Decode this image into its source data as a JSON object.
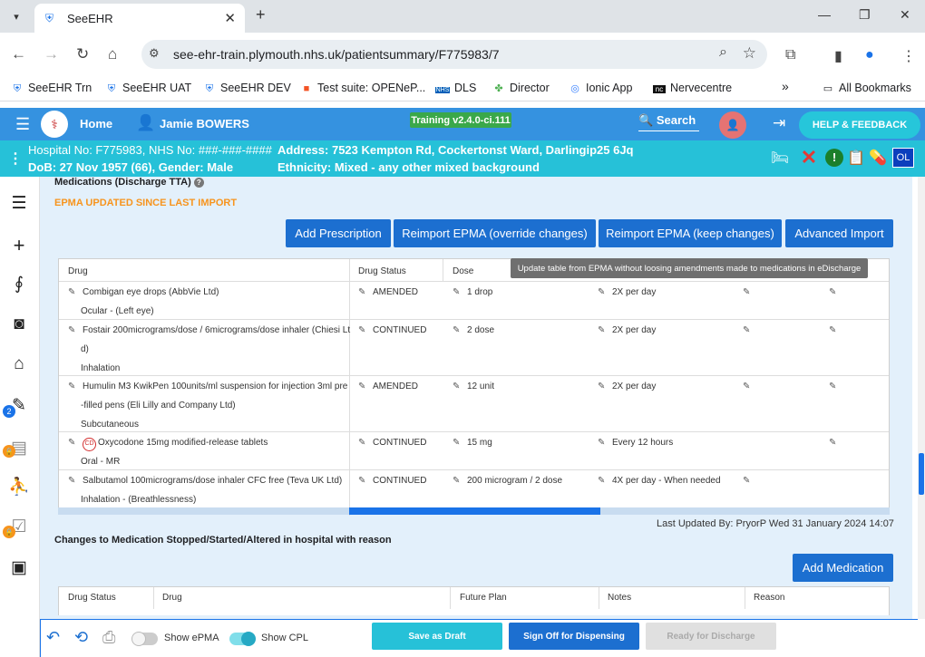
{
  "browser": {
    "tab_title": "SeeEHR",
    "url": "see-ehr-train.plymouth.nhs.uk/patientsummary/F775983/7",
    "bookmarks": [
      {
        "label": "SeeEHR Trn",
        "icon": "shield-icon"
      },
      {
        "label": "SeeEHR UAT",
        "icon": "shield-icon"
      },
      {
        "label": "SeeEHR DEV",
        "icon": "shield-icon"
      },
      {
        "label": "Test suite: OPENeP...",
        "icon": "windows-icon"
      },
      {
        "label": "DLS",
        "icon": "nhs-icon"
      },
      {
        "label": "Director",
        "icon": "puzzle-icon"
      },
      {
        "label": "Ionic App",
        "icon": "ionic-icon"
      },
      {
        "label": "Nervecentre",
        "icon": "nc-icon"
      }
    ],
    "more_label": "»",
    "all_bookmarks": "All Bookmarks",
    "nhs_badge": "NHS",
    "nc_badge": "nc"
  },
  "header": {
    "home": "Home",
    "patient_name": "Jamie BOWERS",
    "training_badge": "Training v2.4.0-ci.111",
    "search": "Search",
    "help": "HELP & FEEDBACK"
  },
  "patient_banner": {
    "hospital_label": "Hospital No: F775983, NHS No: ###-###-####",
    "address": "Address: 7523 Kempton Rd, Cockertonst Ward, Darlingip25 6Jq",
    "dob": "DoB: 27 Nov 1957 (66), Gender: Male",
    "ethnicity": "Ethnicity: Mixed - any other mixed background",
    "ol_badge": "OL"
  },
  "sidebar": {
    "badges": {
      "notes": "2"
    }
  },
  "medications": {
    "title": "Medications (Discharge TTA)",
    "help_glyph": "?",
    "warning": "EPMA UPDATED SINCE LAST IMPORT",
    "buttons": {
      "add_prescription": "Add Prescription",
      "reimport_override": "Reimport EPMA (override changes)",
      "reimport_keep": "Reimport EPMA (keep changes)",
      "advanced_import": "Advanced Import"
    },
    "tooltip": "Update table from EPMA without loosing amendments made to medications in eDischarge",
    "columns": [
      "Drug",
      "Drug Status",
      "Dose"
    ],
    "rows": [
      {
        "drug": "Combigan eye drops (AbbVie Ltd)",
        "route": "Ocular - (Left eye)",
        "status": "AMENDED",
        "dose": "1 drop",
        "frequency": "2X per day"
      },
      {
        "drug": "Fostair 200micrograms/dose / 6micrograms/dose inhaler (Chiesi Lt",
        "drug2": "d)",
        "route": "Inhalation",
        "status": "CONTINUED",
        "dose": "2 dose",
        "frequency": "2X per day"
      },
      {
        "drug": "Humulin M3 KwikPen 100units/ml suspension for injection 3ml pre",
        "drug2": "-filled pens (Eli Lilly and Company Ltd)",
        "route": "Subcutaneous",
        "status": "AMENDED",
        "dose": "12 unit",
        "frequency": "2X per day"
      },
      {
        "drug": "Oxycodone 15mg modified-release tablets",
        "cd": "CD",
        "route": "Oral - MR",
        "status": "CONTINUED",
        "dose": "15 mg",
        "frequency": "Every 12 hours"
      },
      {
        "drug": "Salbutamol 100micrograms/dose inhaler CFC free (Teva UK Ltd)",
        "route": "Inhalation - (Breathlessness)",
        "status": "CONTINUED",
        "dose": "200 microgram / 2 dose",
        "frequency": "4X per day - When needed"
      }
    ],
    "last_updated": "Last Updated By: PryorP Wed 31 January 2024 14:07"
  },
  "changes": {
    "title": "Changes to Medication Stopped/Started/Altered in hospital with reason",
    "add_button": "Add Medication",
    "columns": [
      "Drug Status",
      "Drug",
      "Future Plan",
      "Notes",
      "Reason"
    ]
  },
  "bottom": {
    "show_epma": "Show ePMA",
    "show_cpl": "Show CPL",
    "save_draft": "Save as Draft",
    "sign_off": "Sign Off for Dispensing",
    "ready": "Ready for Discharge"
  }
}
